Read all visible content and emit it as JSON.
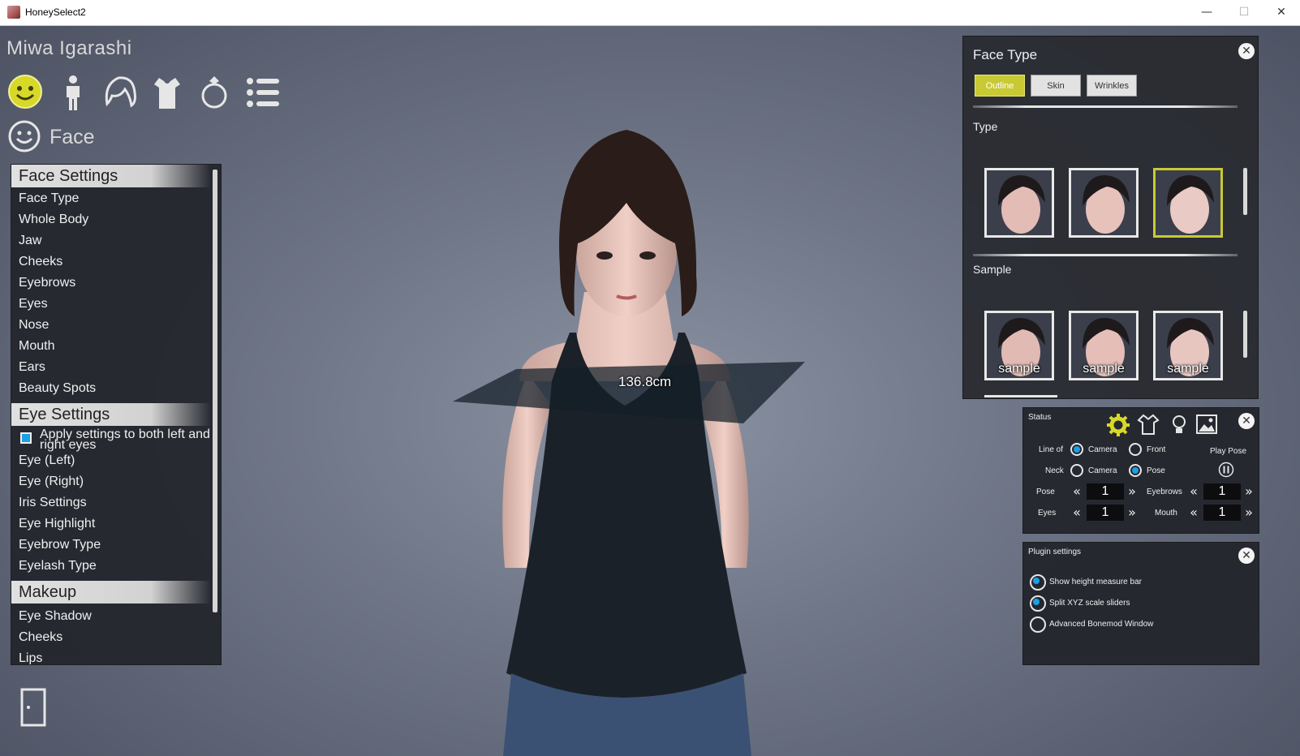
{
  "window": {
    "title": "HoneySelect2",
    "min": "—",
    "max": "☐",
    "close": "✕"
  },
  "character": {
    "name": "Miwa Igarashi"
  },
  "categories": [
    "face-icon",
    "body-icon",
    "hair-icon",
    "clothes-icon",
    "accessory-icon",
    "list-icon"
  ],
  "section": {
    "label": "Face"
  },
  "left_panel": {
    "face_settings": "Face Settings",
    "face_items": [
      "Face Type",
      "Whole Body",
      "Jaw",
      "Cheeks",
      "Eyebrows",
      "Eyes",
      "Nose",
      "Mouth",
      "Ears",
      "Beauty Spots"
    ],
    "eye_settings": "Eye Settings",
    "apply_both": "Apply settings to both left and right eyes",
    "eye_items": [
      "Eye (Left)",
      "Eye (Right)",
      "Iris Settings",
      "Eye Highlight",
      "Eyebrow Type",
      "Eyelash Type"
    ],
    "makeup": "Makeup",
    "makeup_items": [
      "Eye Shadow",
      "Cheeks",
      "Lips"
    ]
  },
  "measure_label": "136.8cm",
  "face_type_panel": {
    "title": "Face Type",
    "tabs": [
      "Outline",
      "Skin",
      "Wrinkles"
    ],
    "active_tab": "Outline",
    "type_label": "Type",
    "sample_label": "Sample",
    "sample_caption": "sample"
  },
  "status_panel": {
    "title": "Status",
    "line_of": "Line of",
    "neck": "Neck",
    "camera": "Camera",
    "front": "Front",
    "pose_opt": "Pose",
    "play_pose": "Play Pose",
    "pose": "Pose",
    "eyes": "Eyes",
    "eyebrows": "Eyebrows",
    "mouth": "Mouth",
    "pose_val": "1",
    "eyes_val": "1",
    "eyebrows_val": "1",
    "mouth_val": "1"
  },
  "plugin_panel": {
    "title": "Plugin settings",
    "options": [
      "Show height measure bar",
      "Split XYZ scale sliders",
      "Advanced Bonemod Window"
    ]
  },
  "colors": {
    "accent_yellow": "#c9c934",
    "accent_blue": "#1aa0e6"
  }
}
